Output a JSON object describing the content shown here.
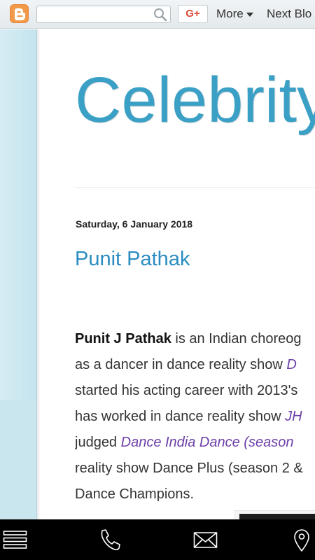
{
  "navbar": {
    "search": {
      "value": "",
      "placeholder": ""
    },
    "gplus_label": "G+",
    "more_label": "More",
    "next_blog_label": "Next Blo"
  },
  "blog": {
    "title": "Celebrity"
  },
  "post": {
    "date": "Saturday, 6 January 2018",
    "title": "Punit Pathak",
    "lines": [
      {
        "parts": [
          {
            "t": "b",
            "text": "Punit J Pathak"
          },
          {
            "t": "n",
            "text": " is an Indian choreog"
          }
        ]
      },
      {
        "parts": [
          {
            "t": "n",
            "text": "as a dancer in dance reality show "
          },
          {
            "t": "a",
            "text": "D"
          }
        ]
      },
      {
        "parts": [
          {
            "t": "n",
            "text": "started his acting career with 2013's"
          }
        ]
      },
      {
        "parts": [
          {
            "t": "n",
            "text": "has worked in dance reality show "
          },
          {
            "t": "a",
            "text": "JH"
          }
        ]
      },
      {
        "parts": [
          {
            "t": "n",
            "text": "judged "
          },
          {
            "t": "a",
            "text": "Dance India Dance (season"
          }
        ]
      },
      {
        "parts": [
          {
            "t": "n",
            "text": "reality show Dance Plus (season 2 &"
          }
        ]
      },
      {
        "parts": [
          {
            "t": "n",
            "text": "Dance Champions."
          }
        ]
      }
    ]
  },
  "bottom_bar": {
    "icons": [
      "menu-icon",
      "phone-icon",
      "mail-icon",
      "location-pin-icon"
    ]
  },
  "colors": {
    "title": "#3aa0c5",
    "post_title": "#2a8cc0",
    "link": "#6c3fa8",
    "blogger_orange": "#f39a4a",
    "gplus_red": "#dd4b39",
    "bottom_bar": "#000000"
  }
}
